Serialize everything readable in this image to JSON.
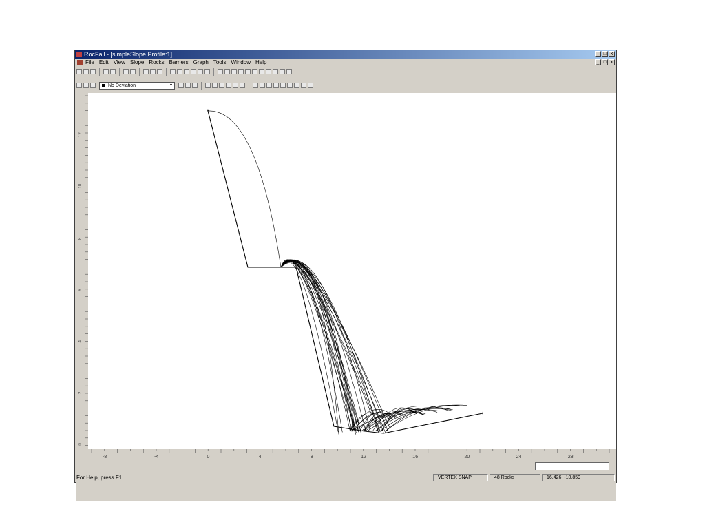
{
  "window": {
    "title": "RocFall - [simpleSlope Profile:1]",
    "buttons": {
      "minimize": "_",
      "restore": "□",
      "close": "x"
    }
  },
  "menu": {
    "items": [
      "File",
      "Edit",
      "View",
      "Slope",
      "Rocks",
      "Barriers",
      "Graph",
      "Tools",
      "Window",
      "Help"
    ]
  },
  "toolbar": {
    "combo_value": "No Deviation"
  },
  "axes": {
    "x_ticks": [
      "-8",
      "-4",
      "0",
      "4",
      "8",
      "12",
      "16",
      "20",
      "24",
      "28"
    ],
    "y_ticks": [
      "12",
      "10",
      "8",
      "6",
      "4",
      "2",
      "0"
    ]
  },
  "status": {
    "help": "For Help, press F1",
    "snap": "VERTEX SNAP",
    "rocks": "48 Rocks",
    "coords": "16.426, -10.859"
  }
}
